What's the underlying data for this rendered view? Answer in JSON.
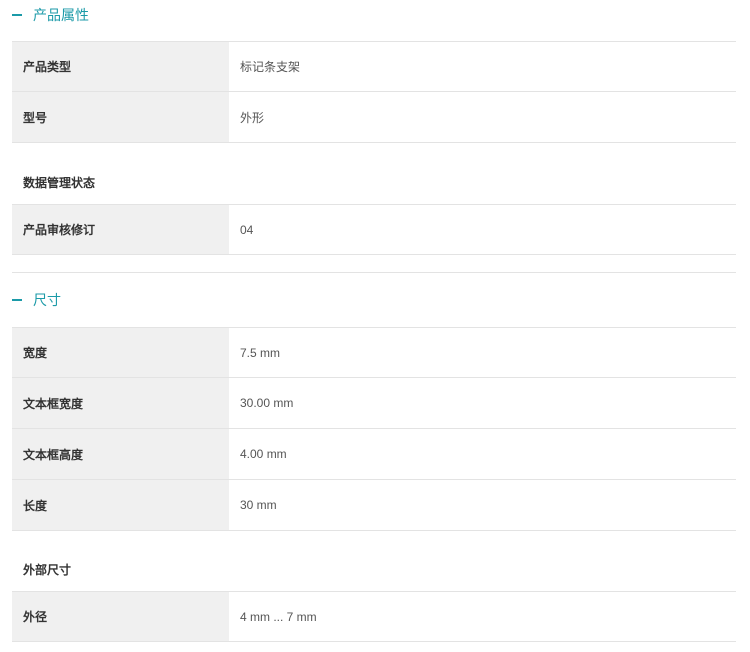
{
  "product_properties": {
    "title": "产品属性",
    "rows": [
      {
        "label": "产品类型",
        "value": "标记条支架"
      },
      {
        "label": "型号",
        "value": "外形"
      }
    ]
  },
  "data_management": {
    "heading": "数据管理状态",
    "rows": [
      {
        "label": "产品审核修订",
        "value": "04"
      }
    ]
  },
  "dimensions": {
    "title": "尺寸",
    "rows": [
      {
        "label": "宽度",
        "value": "7.5 mm"
      },
      {
        "label": "文本框宽度",
        "value": "30.00 mm"
      },
      {
        "label": "文本框高度",
        "value": "4.00 mm"
      },
      {
        "label": "长度",
        "value": "30 mm"
      }
    ]
  },
  "outer_dimensions": {
    "heading": "外部尺寸",
    "rows": [
      {
        "label": "外径",
        "value": "4 mm ... 7 mm"
      }
    ]
  },
  "icons": {
    "collapse": "minus-icon"
  },
  "colors": {
    "accent": "#1b9aa8",
    "label_bg": "#f0f0f0",
    "border": "#e3e3e3"
  }
}
